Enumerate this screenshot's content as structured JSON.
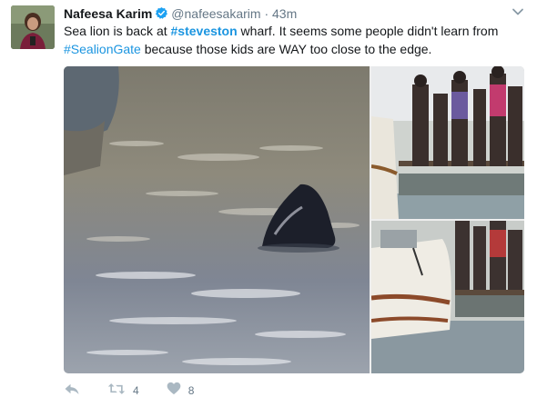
{
  "tweet": {
    "author_name": "Nafeesa Karim",
    "handle": "@nafeesakarim",
    "separator": "·",
    "time": "43m",
    "text_1": "Sea lion is back at ",
    "hashtag_1": "#steveston",
    "text_2": " wharf. It seems some people didn't learn from ",
    "hashtag_2": "#SealionGate",
    "text_3": " because those kids are WAY too close to the edge.",
    "retweet_count": "4",
    "like_count": "8"
  },
  "icons": {
    "verified": "verified-badge-icon",
    "menu": "chevron-down-icon",
    "reply": "reply-icon",
    "retweet": "retweet-icon",
    "like": "heart-icon"
  },
  "colors": {
    "link": "#1b95e0",
    "muted": "#657786",
    "verified": "#1da1f2"
  }
}
